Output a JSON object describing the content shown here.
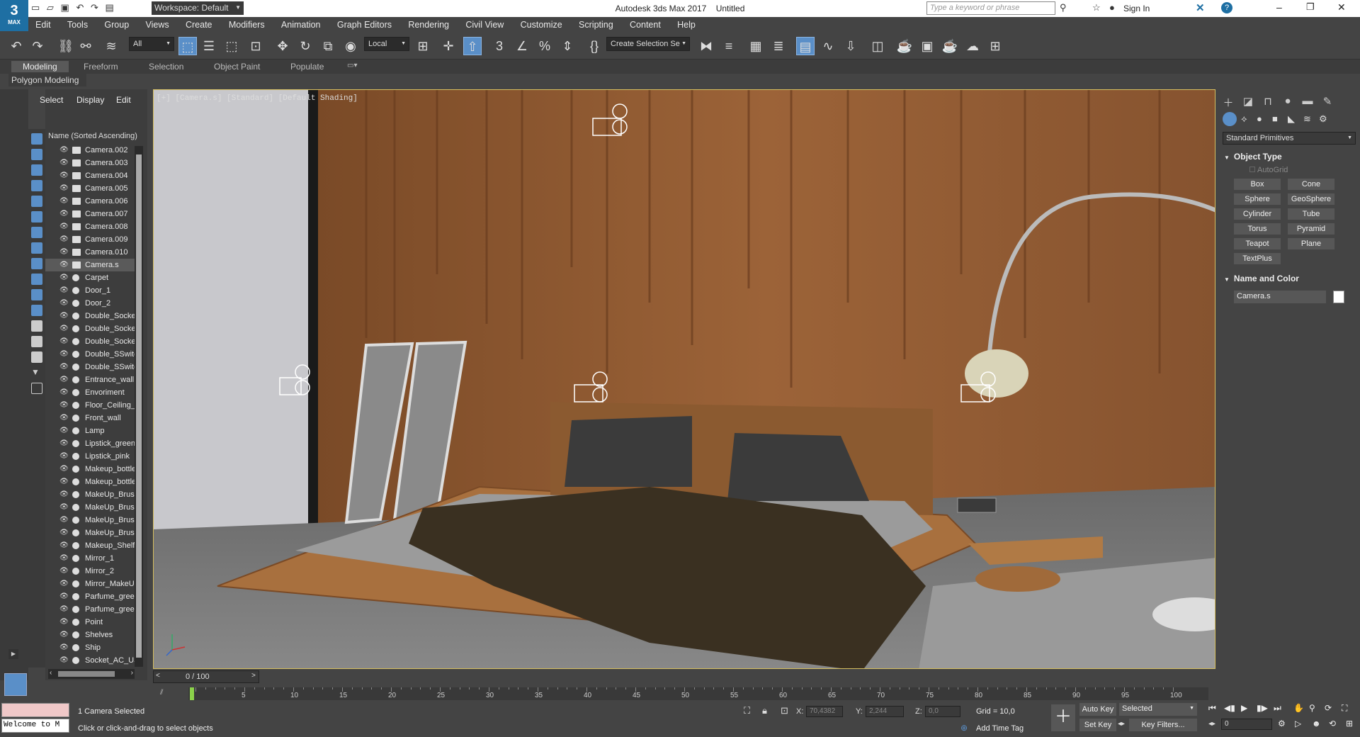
{
  "window": {
    "title": "Autodesk 3ds Max 2017",
    "doc": "Untitled",
    "workspace": "Workspace: Default",
    "search_placeholder": "Type a keyword or phrase",
    "signin": "Sign In",
    "logo": "3",
    "logo_sub": "MAX"
  },
  "menu": [
    "Edit",
    "Tools",
    "Group",
    "Views",
    "Create",
    "Modifiers",
    "Animation",
    "Graph Editors",
    "Rendering",
    "Civil View",
    "Customize",
    "Scripting",
    "Content",
    "Help"
  ],
  "toolbar": {
    "filter": "All",
    "coord": "Local",
    "selection_set": "Create Selection Se"
  },
  "ribbon": {
    "tabs": [
      "Modeling",
      "Freeform",
      "Selection",
      "Object Paint",
      "Populate"
    ],
    "sub": "Polygon Modeling"
  },
  "explorer": {
    "tabs": [
      "Select",
      "Display",
      "Edit"
    ],
    "header": "Name (Sorted Ascending)",
    "items": [
      {
        "name": "Camera.002",
        "type": "cam"
      },
      {
        "name": "Camera.003",
        "type": "cam"
      },
      {
        "name": "Camera.004",
        "type": "cam"
      },
      {
        "name": "Camera.005",
        "type": "cam"
      },
      {
        "name": "Camera.006",
        "type": "cam"
      },
      {
        "name": "Camera.007",
        "type": "cam"
      },
      {
        "name": "Camera.008",
        "type": "cam"
      },
      {
        "name": "Camera.009",
        "type": "cam"
      },
      {
        "name": "Camera.010",
        "type": "cam"
      },
      {
        "name": "Camera.s",
        "type": "cam",
        "selected": true
      },
      {
        "name": "Carpet",
        "type": "obj"
      },
      {
        "name": "Door_1",
        "type": "obj"
      },
      {
        "name": "Door_2",
        "type": "obj"
      },
      {
        "name": "Double_Socket",
        "type": "obj"
      },
      {
        "name": "Double_Socket",
        "type": "obj"
      },
      {
        "name": "Double_Socket",
        "type": "obj"
      },
      {
        "name": "Double_SSwitc",
        "type": "obj"
      },
      {
        "name": "Double_SSwitc",
        "type": "obj"
      },
      {
        "name": "Entrance_wall",
        "type": "obj"
      },
      {
        "name": "Envoriment",
        "type": "obj"
      },
      {
        "name": "Floor_Ceiling_E",
        "type": "obj"
      },
      {
        "name": "Front_wall",
        "type": "obj"
      },
      {
        "name": "Lamp",
        "type": "obj"
      },
      {
        "name": "Lipstick_green",
        "type": "obj"
      },
      {
        "name": "Lipstick_pink",
        "type": "obj"
      },
      {
        "name": "Makeup_bottle",
        "type": "obj"
      },
      {
        "name": "Makeup_bottle",
        "type": "obj"
      },
      {
        "name": "MakeUp_Brush",
        "type": "obj"
      },
      {
        "name": "MakeUp_Brush",
        "type": "obj"
      },
      {
        "name": "MakeUp_Brush",
        "type": "obj"
      },
      {
        "name": "MakeUp_Brush",
        "type": "obj"
      },
      {
        "name": "Makeup_Shelf",
        "type": "obj"
      },
      {
        "name": "Mirror_1",
        "type": "obj"
      },
      {
        "name": "Mirror_2",
        "type": "obj"
      },
      {
        "name": "Mirror_MakeUp",
        "type": "obj"
      },
      {
        "name": "Parfume_green",
        "type": "obj"
      },
      {
        "name": "Parfume_green",
        "type": "obj"
      },
      {
        "name": "Point",
        "type": "light"
      },
      {
        "name": "Shelves",
        "type": "obj"
      },
      {
        "name": "Ship",
        "type": "obj"
      },
      {
        "name": "Socket_AC_US",
        "type": "obj"
      }
    ]
  },
  "viewport": {
    "label": "[+] [Camera.s] [Standard] [Default Shading]"
  },
  "command_panel": {
    "category": "Standard Primitives",
    "object_type_title": "Object Type",
    "autogrid": "AutoGrid",
    "buttons": [
      "Box",
      "Cone",
      "Sphere",
      "GeoSphere",
      "Cylinder",
      "Tube",
      "Torus",
      "Pyramid",
      "Teapot",
      "Plane",
      "TextPlus"
    ],
    "name_color_title": "Name and Color",
    "object_name": "Camera.s",
    "object_color": "#ffffff"
  },
  "timeline": {
    "frame": "0 / 100",
    "ticks": [
      "0",
      "5",
      "10",
      "15",
      "20",
      "25",
      "30",
      "35",
      "40",
      "45",
      "50",
      "55",
      "60",
      "65",
      "70",
      "75",
      "80",
      "85",
      "90",
      "95",
      "100"
    ]
  },
  "status": {
    "listener": "Welcome to M",
    "selected": "1 Camera Selected",
    "prompt": "Click or click-and-drag to select objects",
    "x_label": "X:",
    "x_value": "70,4382",
    "y_label": "Y:",
    "y_value": "2,244",
    "z_label": "Z:",
    "z_value": "0,0",
    "grid": "Grid = 10,0",
    "add_time_tag": "Add Time Tag",
    "auto_key": "Auto Key",
    "set_key": "Set Key",
    "key_mode": "Selected",
    "key_filters": "Key Filters...",
    "frame_field": "0"
  }
}
